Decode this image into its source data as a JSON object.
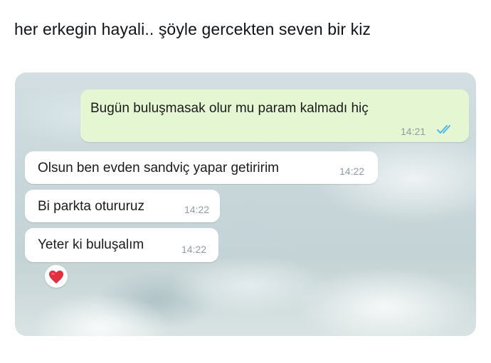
{
  "post": {
    "text": "her erkegin hayali.. şöyle gercekten seven bir kiz"
  },
  "chat": {
    "messages": [
      {
        "direction": "outgoing",
        "text": "Bugün buluşmasak olur mu param kalmadı hiç",
        "time": "14:21",
        "status_icon": "double-check-read-icon"
      },
      {
        "direction": "incoming",
        "text": "Olsun ben evden sandviç yapar getiririm",
        "time": "14:22"
      },
      {
        "direction": "incoming",
        "text": "Bi parkta otururuz",
        "time": "14:22"
      },
      {
        "direction": "incoming",
        "text": "Yeter ki buluşalım",
        "time": "14:22"
      }
    ],
    "reaction": {
      "icon": "red-heart-icon",
      "color": "#e0303d"
    },
    "colors": {
      "outgoing_bubble": "#e4f7d2",
      "incoming_bubble": "#ffffff",
      "read_tick": "#4fb6ec"
    }
  }
}
